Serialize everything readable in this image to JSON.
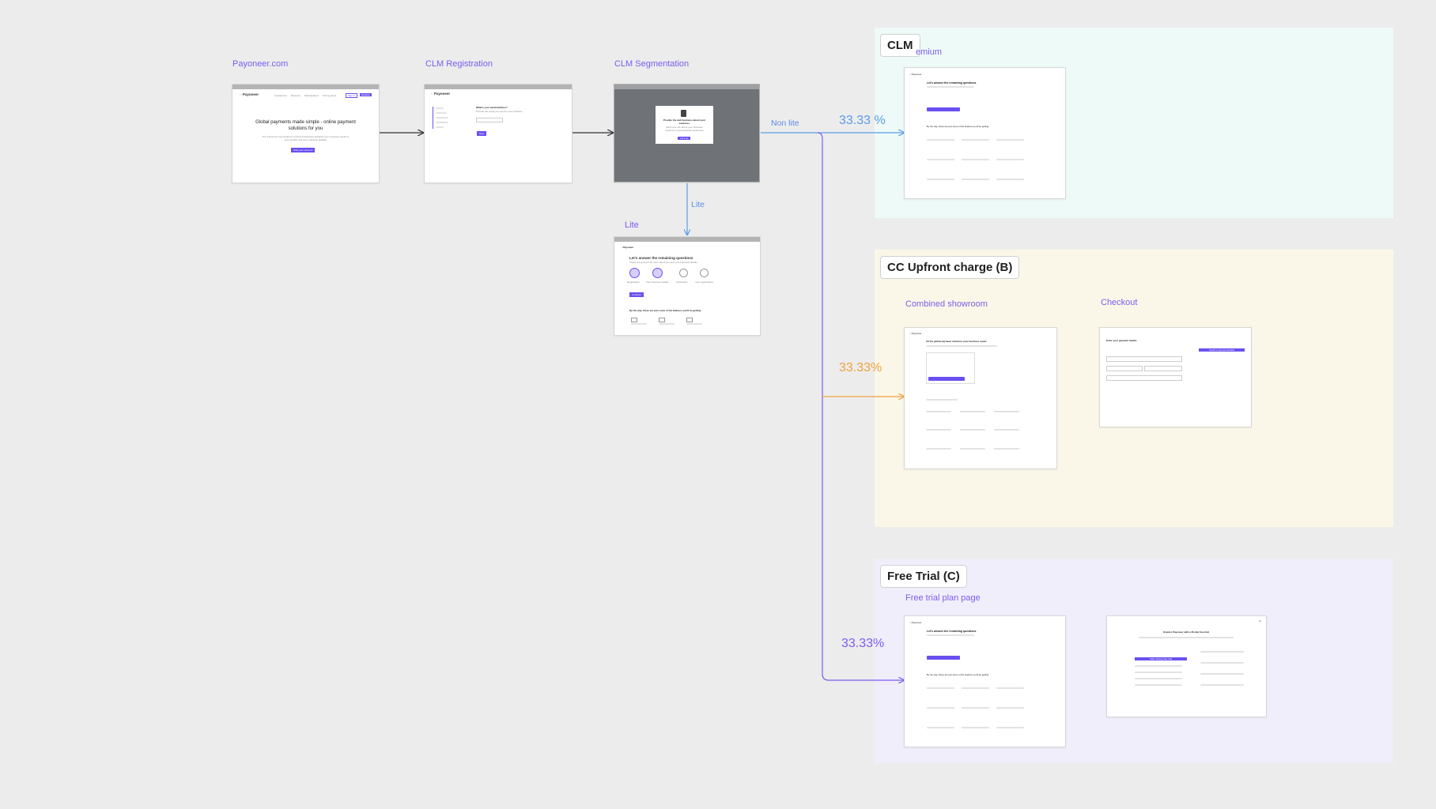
{
  "flow": {
    "payoneer": {
      "label": "Payoneer.com",
      "nav": [
        "Freelancers",
        "Business",
        "Marketplaces",
        "Pricing plans"
      ],
      "signin": "Sign in",
      "register": "Register",
      "headline": "Global payments made simple - online payment solutions for you",
      "sub": "The Payoneer fund solutions connect businesses anything your company needs to your growth, and every decision globally",
      "cta": "Start your account"
    },
    "registration": {
      "label": "CLM Registration",
      "question": "What's your email address?",
      "sub": "Provide the email you use for your business",
      "button": "Next"
    },
    "segmentation": {
      "label": "CLM Segmentation",
      "modal_title": "Provide the web business about your business",
      "modal_sub": "Add more info about your business needs for a personalized experience",
      "modal_button": "Let's go"
    },
    "lite": {
      "label": "Lite",
      "edge": "Lite",
      "title": "Let's answer the remaining questions",
      "sub": "These are going to be more about you and your business details",
      "steps": [
        "Registration",
        "Your business details",
        "Verification",
        "Your organization"
      ],
      "button": "Continue",
      "features_title": "By the way, these are just some of the features you'll be getting"
    },
    "edges": {
      "non_lite": "Non lite"
    }
  },
  "groups": {
    "clm": {
      "title": "CLM",
      "sub_label": "emium",
      "percent": "33.33 %",
      "color": "#5b9bea"
    },
    "cc": {
      "title": "CC Upfront charge (B)",
      "percent": "33.33%",
      "color": "#f0a040",
      "showroom_label": "Combined showroom",
      "checkout_label": "Checkout",
      "showroom_title": "All the global payment solutions your business needs",
      "checkout_title": "Enter your payment details",
      "checkout_pay_button": "Confirm payment details"
    },
    "trial": {
      "title": "Free Trial (C)",
      "percent": "33.33%",
      "color": "#7b5cf0",
      "plan_label": "Free trial plan page",
      "trial_title": "Explore Payoneer with a 30-day free trial",
      "trial_button": "Start 30-day free trial"
    }
  },
  "colors": {
    "accent": "#7b5cf0",
    "blue": "#5b9bea",
    "orange": "#f0a040",
    "clm_bg": "#edfaf8",
    "cc_bg": "#fbf7e8",
    "trial_bg": "#f1eefb"
  }
}
